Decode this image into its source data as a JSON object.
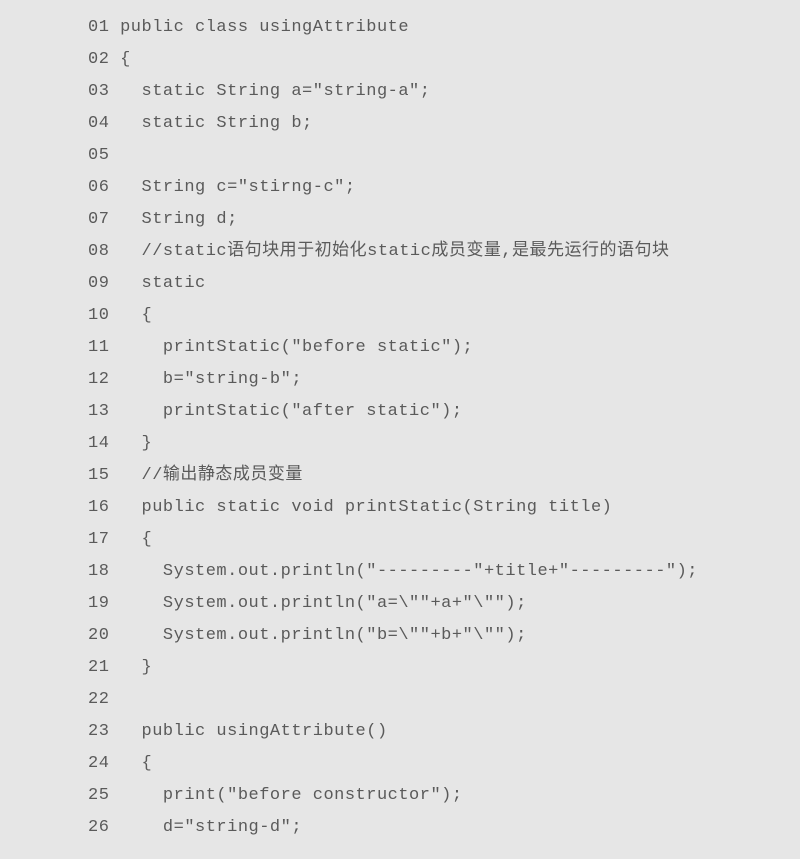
{
  "code": {
    "lines": [
      {
        "num": "01",
        "text": " public class usingAttribute"
      },
      {
        "num": "02",
        "text": " {"
      },
      {
        "num": "03",
        "text": "   static String a=\"string-a\";"
      },
      {
        "num": "04",
        "text": "   static String b;"
      },
      {
        "num": "05",
        "text": ""
      },
      {
        "num": "06",
        "text": "   String c=\"stirng-c\";"
      },
      {
        "num": "07",
        "text": "   String d;"
      },
      {
        "num": "08",
        "text": "   //static语句块用于初始化static成员变量,是最先运行的语句块"
      },
      {
        "num": "09",
        "text": "   static"
      },
      {
        "num": "10",
        "text": "   {"
      },
      {
        "num": "11",
        "text": "     printStatic(\"before static\");"
      },
      {
        "num": "12",
        "text": "     b=\"string-b\";"
      },
      {
        "num": "13",
        "text": "     printStatic(\"after static\");"
      },
      {
        "num": "14",
        "text": "   }"
      },
      {
        "num": "15",
        "text": "   //输出静态成员变量"
      },
      {
        "num": "16",
        "text": "   public static void printStatic(String title)"
      },
      {
        "num": "17",
        "text": "   {"
      },
      {
        "num": "18",
        "text": "     System.out.println(\"---------\"+title+\"---------\");"
      },
      {
        "num": "19",
        "text": "     System.out.println(\"a=\\\"\"+a+\"\\\"\");"
      },
      {
        "num": "20",
        "text": "     System.out.println(\"b=\\\"\"+b+\"\\\"\");"
      },
      {
        "num": "21",
        "text": "   }"
      },
      {
        "num": "22",
        "text": ""
      },
      {
        "num": "23",
        "text": "   public usingAttribute()"
      },
      {
        "num": "24",
        "text": "   {"
      },
      {
        "num": "25",
        "text": "     print(\"before constructor\");"
      },
      {
        "num": "26",
        "text": "     d=\"string-d\";"
      }
    ]
  }
}
